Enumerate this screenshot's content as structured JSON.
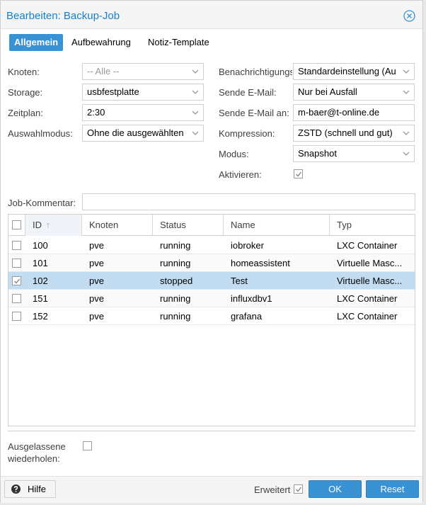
{
  "window": {
    "title": "Bearbeiten: Backup-Job"
  },
  "tabs": [
    {
      "label": "Allgemein",
      "active": true
    },
    {
      "label": "Aufbewahrung",
      "active": false
    },
    {
      "label": "Notiz-Template",
      "active": false
    }
  ],
  "form": {
    "knoten": {
      "label": "Knoten:",
      "placeholder": "-- Alle --"
    },
    "storage": {
      "label": "Storage:",
      "value": "usbfestplatte"
    },
    "zeitplan": {
      "label": "Zeitplan:",
      "value": "2:30"
    },
    "auswahlmodus": {
      "label": "Auswahlmodus:",
      "value": "Ohne die ausgewählten"
    },
    "benachrichtigung": {
      "label": "Benachrichtigungs",
      "value": "Standardeinstellung (Au"
    },
    "sende_email": {
      "label": "Sende E-Mail:",
      "value": "Nur bei Ausfall"
    },
    "sende_email_an": {
      "label": "Sende E-Mail an:",
      "value": "m-baer@t-online.de"
    },
    "kompression": {
      "label": "Kompression:",
      "value": "ZSTD (schnell und gut)"
    },
    "modus": {
      "label": "Modus:",
      "value": "Snapshot"
    },
    "aktivieren": {
      "label": "Aktivieren:",
      "checked": true
    },
    "job_kommentar": {
      "label": "Job-Kommentar:",
      "value": ""
    }
  },
  "grid": {
    "columns": [
      "ID",
      "Knoten",
      "Status",
      "Name",
      "Typ"
    ],
    "sort_indicator": "↑",
    "rows": [
      {
        "id": "100",
        "knoten": "pve",
        "status": "running",
        "name": "iobroker",
        "typ": "LXC Container",
        "selected": false
      },
      {
        "id": "101",
        "knoten": "pve",
        "status": "running",
        "name": "homeassistent",
        "typ": "Virtuelle Masc...",
        "selected": false
      },
      {
        "id": "102",
        "knoten": "pve",
        "status": "stopped",
        "name": "Test",
        "typ": "Virtuelle Masc...",
        "selected": true
      },
      {
        "id": "151",
        "knoten": "pve",
        "status": "running",
        "name": "influxdbv1",
        "typ": "LXC Container",
        "selected": false
      },
      {
        "id": "152",
        "knoten": "pve",
        "status": "running",
        "name": "grafana",
        "typ": "LXC Container",
        "selected": false
      }
    ]
  },
  "repeat_missed": {
    "label_line1": "Ausgelassene",
    "label_line2": "wiederholen:",
    "checked": false
  },
  "footer": {
    "help_label": "Hilfe",
    "advanced_label": "Erweitert",
    "advanced_checked": true,
    "ok_label": "OK",
    "reset_label": "Reset"
  },
  "colors": {
    "accent": "#3892d4",
    "title": "#157fcc",
    "selected_row": "#c2ddf2"
  }
}
